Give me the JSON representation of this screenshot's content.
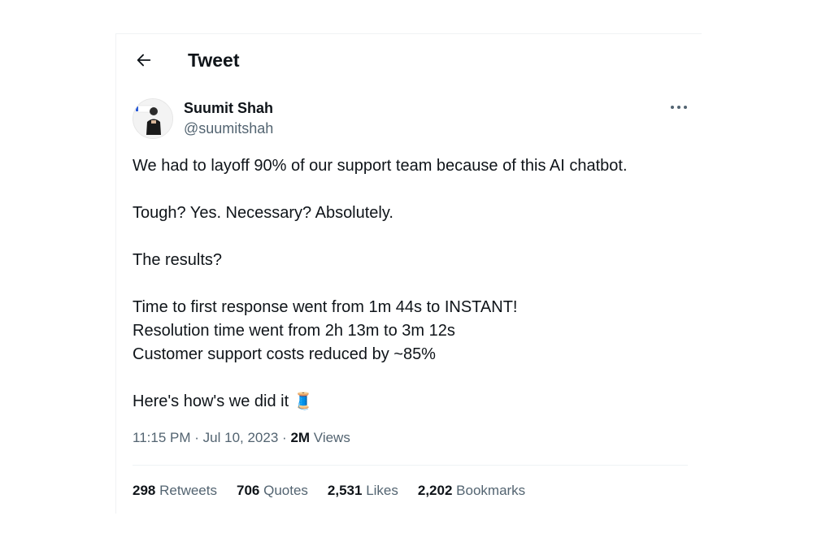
{
  "header": {
    "title": "Tweet"
  },
  "author": {
    "name": "Suumit Shah",
    "handle": "@suumitshah"
  },
  "tweet": {
    "lines": [
      "We had to layoff 90% of our support team because of this AI chatbot.",
      "Tough? Yes. Necessary? Absolutely.",
      "The results?",
      "Time to first response went from 1m 44s to INSTANT!",
      "Resolution time went from 2h 13m to 3m 12s",
      "Customer support costs reduced by ~85%",
      "Here's how's we did it"
    ],
    "thread_emoji": "🧵"
  },
  "meta": {
    "time": "11:15 PM",
    "sep1": "·",
    "date": "Jul 10, 2023",
    "sep2": "·",
    "views_count": "2M",
    "views_label": "Views"
  },
  "stats": [
    {
      "count": "298",
      "label": "Retweets"
    },
    {
      "count": "706",
      "label": "Quotes"
    },
    {
      "count": "2,531",
      "label": "Likes"
    },
    {
      "count": "2,202",
      "label": "Bookmarks"
    }
  ],
  "colors": {
    "text": "#0f1419",
    "secondary": "#536471",
    "divider": "#eff3f4"
  },
  "icons": {
    "back": "arrow-left-icon",
    "more": "more-horizontal-icon"
  }
}
